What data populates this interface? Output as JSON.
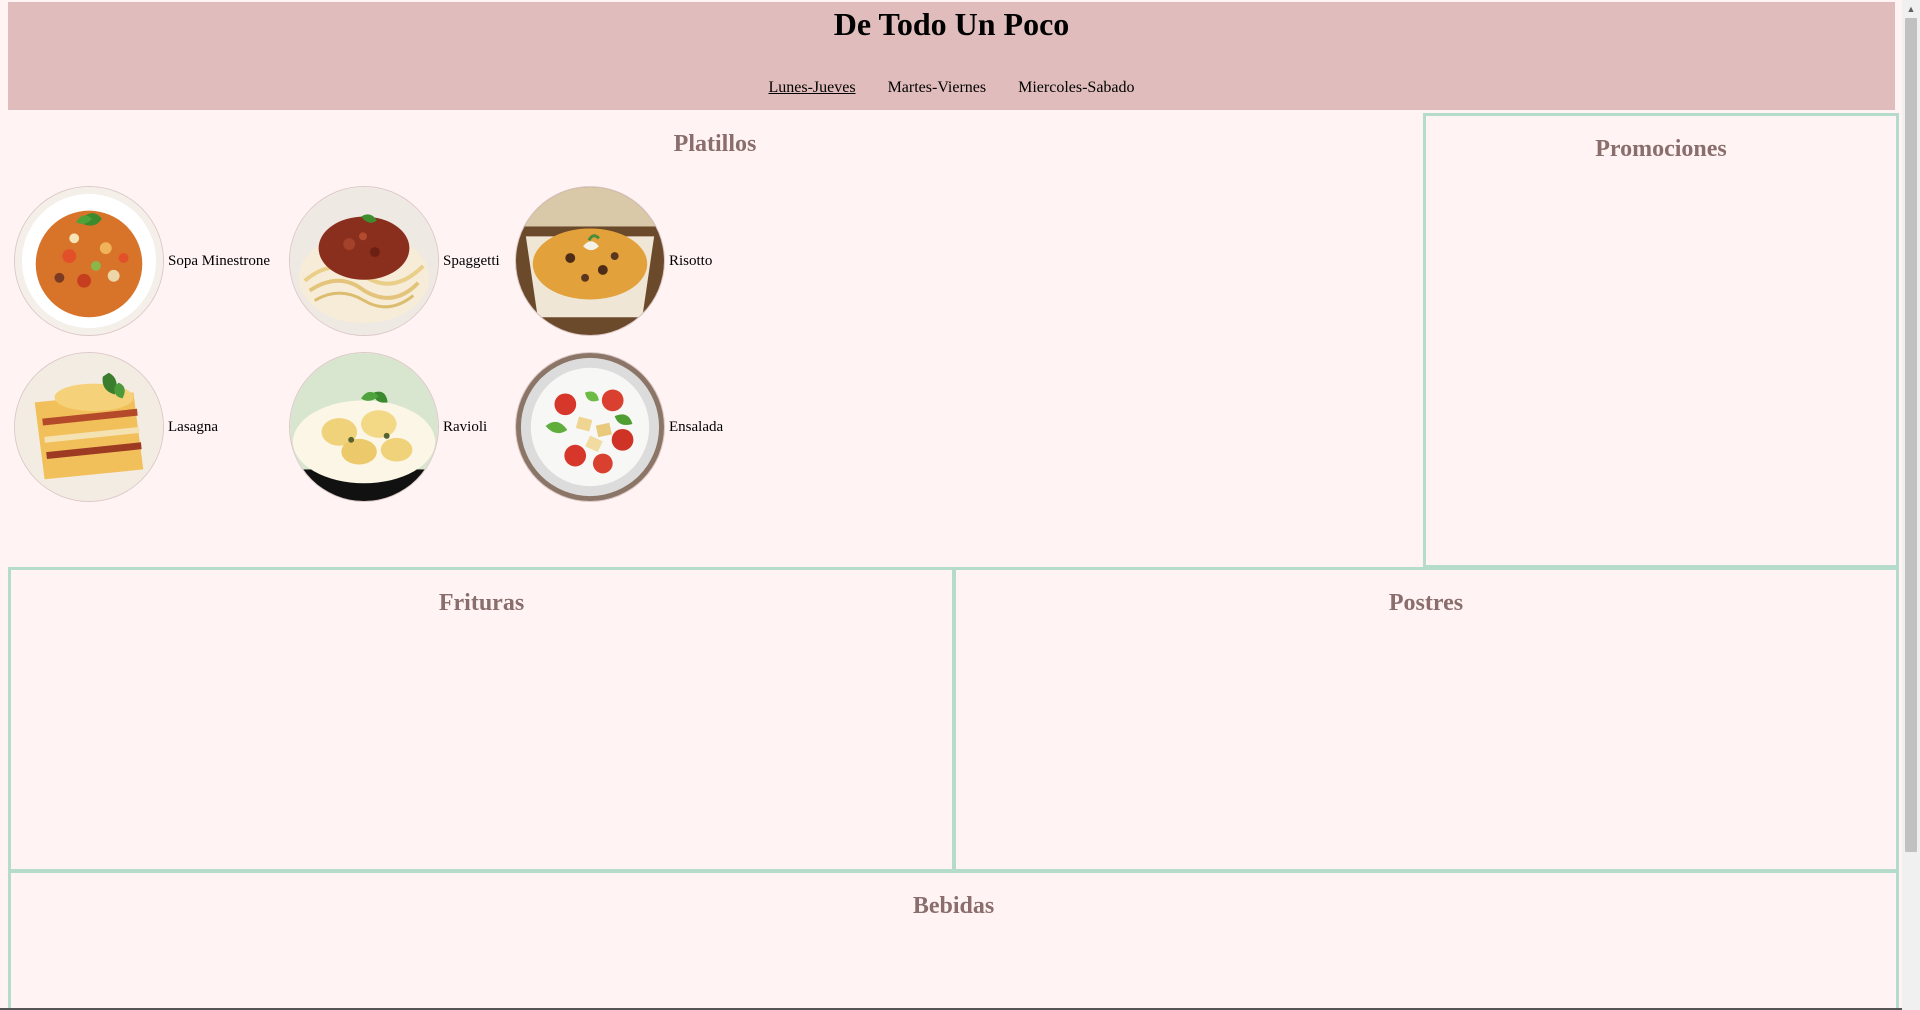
{
  "header": {
    "title": "De Todo Un Poco",
    "nav": [
      "Lunes-Jueves",
      "Martes-Viernes",
      "Miercoles-Sabado"
    ]
  },
  "sections": {
    "platillos": "Platillos",
    "promociones": "Promociones",
    "frituras": "Frituras",
    "postres": "Postres",
    "bebidas": "Bebidas"
  },
  "dishes": [
    {
      "name": "Sopa Minestrone",
      "icon": "soup-image"
    },
    {
      "name": "Spaggetti",
      "icon": "spaghetti-image"
    },
    {
      "name": "Risotto",
      "icon": "risotto-image"
    },
    {
      "name": "Lasagna",
      "icon": "lasagna-image"
    },
    {
      "name": "Ravioli",
      "icon": "ravioli-image"
    },
    {
      "name": "Ensalada",
      "icon": "salad-image"
    }
  ],
  "colors": {
    "header_bg": "#e0bdbc",
    "page_bg": "#fff4f3",
    "section_border": "#b5dccb",
    "section_title": "#8a6d6d"
  }
}
